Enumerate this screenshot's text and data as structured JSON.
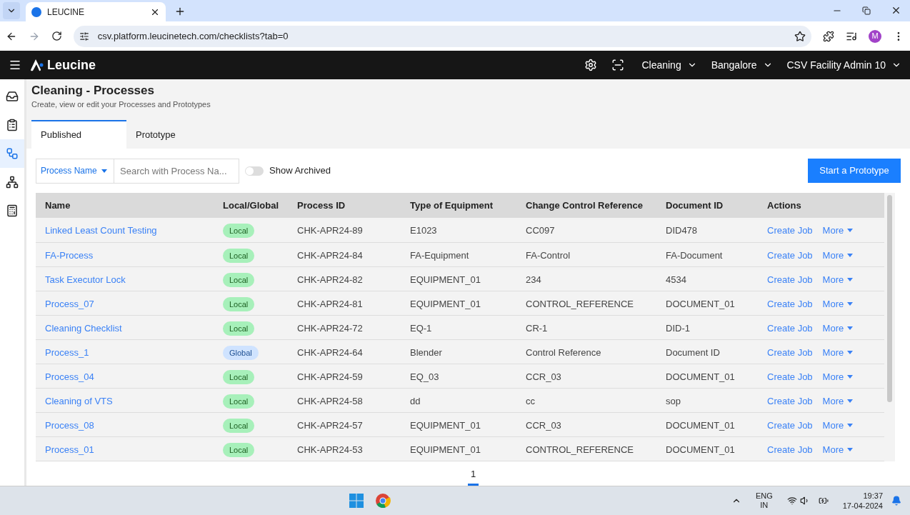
{
  "browser": {
    "tab_title": "LEUCINE",
    "url": "csv.platform.leucinetech.com/checklists?tab=0",
    "avatar": "M"
  },
  "header": {
    "brand": "Leucine",
    "menus": [
      "Cleaning",
      "Bangalore",
      "CSV Facility Admin 10"
    ]
  },
  "sidebar": {
    "items": [
      {
        "kind": "inbox",
        "selected": false
      },
      {
        "kind": "checklist",
        "selected": false
      },
      {
        "kind": "process",
        "selected": true
      },
      {
        "kind": "hierarchy",
        "selected": false
      },
      {
        "kind": "report",
        "selected": false
      }
    ]
  },
  "page": {
    "title": "Cleaning - Processes",
    "subtitle": "Create, view or edit your Processes and Prototypes"
  },
  "tabs": [
    {
      "label": "Published",
      "selected": true
    },
    {
      "label": "Prototype",
      "selected": false
    }
  ],
  "filter": {
    "dropdown": "Process Name",
    "placeholder": "Search with Process Na...",
    "toggle": {
      "label": "Show Archived",
      "on": false
    },
    "button": "Start a Prototype"
  },
  "table": {
    "columns": [
      "Name",
      "Local/Global",
      "Process ID",
      "Type of Equipment",
      "Change Control Reference",
      "Document ID",
      "Actions"
    ],
    "rows": [
      {
        "name": "Linked Least Count Testing",
        "scope": {
          "label": "Local",
          "kind": "local"
        },
        "process_id": "CHK-APR24-89",
        "equipment": "E1023",
        "change_ref": "CC097",
        "document_id": "DID478",
        "actions": [
          "Create Job",
          "More"
        ]
      },
      {
        "name": "FA-Process",
        "scope": {
          "label": "Local",
          "kind": "local"
        },
        "process_id": "CHK-APR24-84",
        "equipment": "FA-Equipment",
        "change_ref": "FA-Control",
        "document_id": "FA-Document",
        "actions": [
          "Create Job",
          "More"
        ]
      },
      {
        "name": "Task Executor Lock",
        "scope": {
          "label": "Local",
          "kind": "local"
        },
        "process_id": "CHK-APR24-82",
        "equipment": "EQUIPMENT_01",
        "change_ref": "234",
        "document_id": "4534",
        "actions": [
          "Create Job",
          "More"
        ]
      },
      {
        "name": "Process_07",
        "scope": {
          "label": "Local",
          "kind": "local"
        },
        "process_id": "CHK-APR24-81",
        "equipment": "EQUIPMENT_01",
        "change_ref": "CONTROL_REFERENCE",
        "document_id": "DOCUMENT_01",
        "actions": [
          "Create Job",
          "More"
        ]
      },
      {
        "name": "Cleaning Checklist",
        "scope": {
          "label": "Local",
          "kind": "local"
        },
        "process_id": "CHK-APR24-72",
        "equipment": "EQ-1",
        "change_ref": "CR-1",
        "document_id": "DID-1",
        "actions": [
          "Create Job",
          "More"
        ]
      },
      {
        "name": "Process_1",
        "scope": {
          "label": "Global",
          "kind": "global"
        },
        "process_id": "CHK-APR24-64",
        "equipment": "Blender",
        "change_ref": "Control Reference",
        "document_id": "Document ID",
        "actions": [
          "Create Job",
          "More"
        ]
      },
      {
        "name": "Process_04",
        "scope": {
          "label": "Local",
          "kind": "local"
        },
        "process_id": "CHK-APR24-59",
        "equipment": "EQ_03",
        "change_ref": "CCR_03",
        "document_id": "DOCUMENT_01",
        "actions": [
          "Create Job",
          "More"
        ]
      },
      {
        "name": "Cleaning of VTS",
        "scope": {
          "label": "Local",
          "kind": "local"
        },
        "process_id": "CHK-APR24-58",
        "equipment": "dd",
        "change_ref": "cc",
        "document_id": "sop",
        "actions": [
          "Create Job",
          "More"
        ]
      },
      {
        "name": "Process_08",
        "scope": {
          "label": "Local",
          "kind": "local"
        },
        "process_id": "CHK-APR24-57",
        "equipment": "EQUIPMENT_01",
        "change_ref": "CCR_03",
        "document_id": "DOCUMENT_01",
        "actions": [
          "Create Job",
          "More"
        ]
      },
      {
        "name": "Process_01",
        "scope": {
          "label": "Local",
          "kind": "local"
        },
        "process_id": "CHK-APR24-53",
        "equipment": "EQUIPMENT_01",
        "change_ref": "CONTROL_REFERENCE",
        "document_id": "DOCUMENT_01",
        "actions": [
          "Create Job",
          "More"
        ]
      }
    ]
  },
  "pagination": [
    {
      "label": "1",
      "selected": true
    }
  ],
  "taskbar": {
    "language": "ENG",
    "region": "IN",
    "time": "19:37",
    "date": "17-04-2024"
  }
}
